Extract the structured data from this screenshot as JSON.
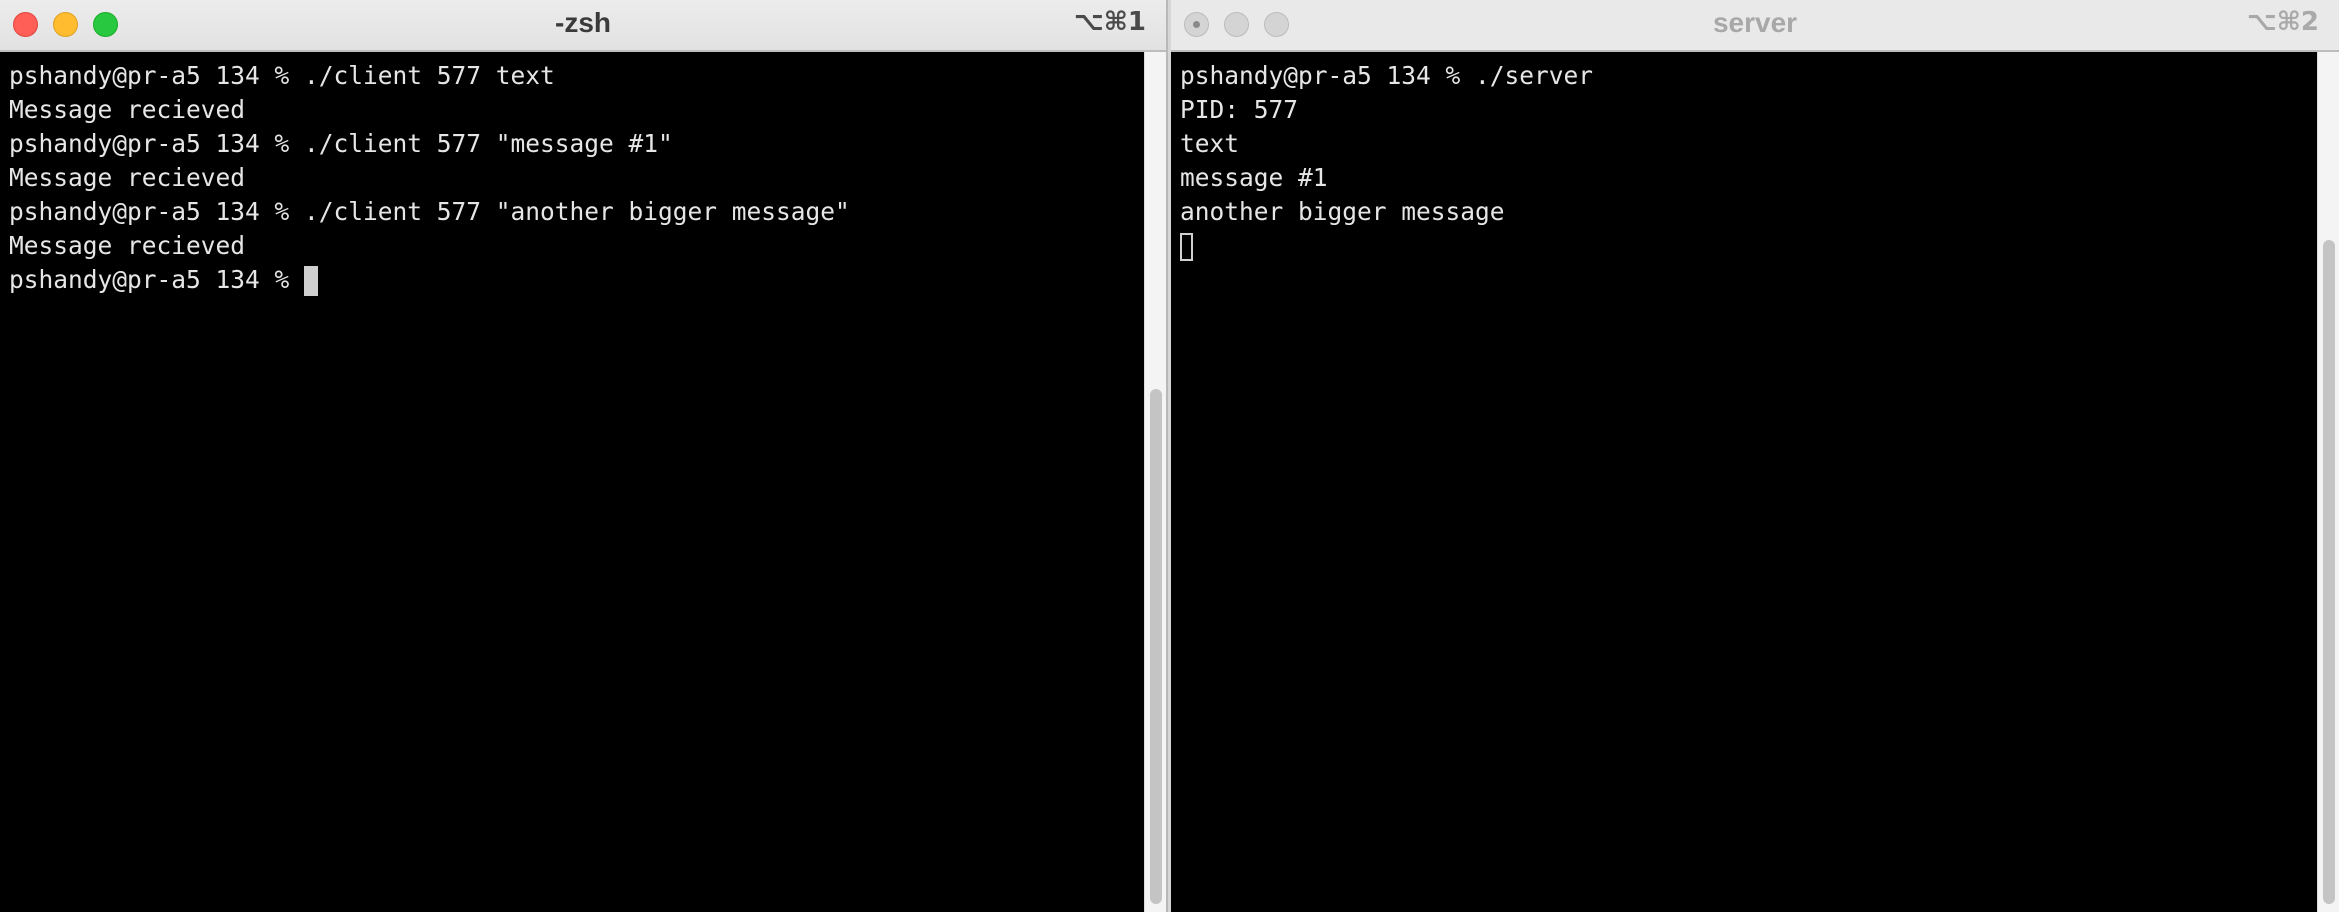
{
  "left_window": {
    "title": "-zsh",
    "shortcut": "⌥⌘1",
    "lines": [
      "pshandy@pr-a5 134 % ./client 577 text",
      "Message recieved",
      "pshandy@pr-a5 134 % ./client 577 \"message #1\"",
      "Message recieved",
      "pshandy@pr-a5 134 % ./client 577 \"another bigger message\"",
      "Message recieved"
    ],
    "prompt": "pshandy@pr-a5 134 % "
  },
  "right_window": {
    "title": "server",
    "shortcut": "⌥⌘2",
    "lines": [
      "pshandy@pr-a5 134 % ./server",
      "PID: 577",
      "text",
      "message #1",
      "another bigger message"
    ]
  },
  "colors": {
    "terminal_bg": "#000000",
    "terminal_fg": "#e6e6e6",
    "close": "#ff5f57",
    "minimize": "#febc2e",
    "maximize": "#28c840"
  }
}
